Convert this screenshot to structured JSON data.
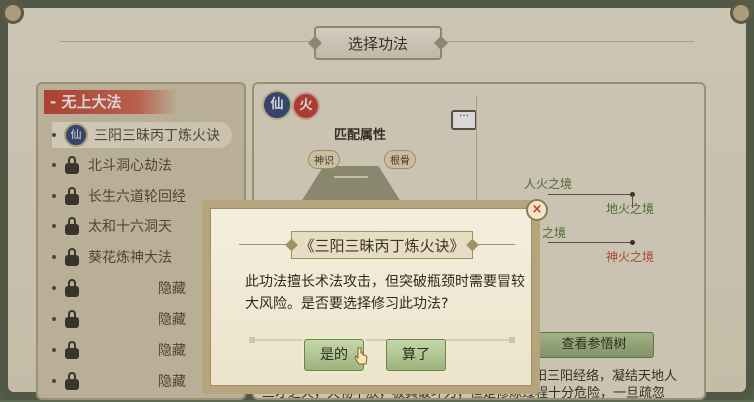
{
  "header": {
    "title": "选择功法"
  },
  "left_panel": {
    "category": "无上大法",
    "items": [
      {
        "label": "三阳三昧丙丁炼火诀",
        "state": "selected",
        "icon": "xian-icon"
      },
      {
        "label": "北斗洞心劫法",
        "state": "locked",
        "icon": "lock-icon"
      },
      {
        "label": "长生六道轮回经",
        "state": "locked",
        "icon": "lock-icon"
      },
      {
        "label": "太和十六洞天",
        "state": "locked",
        "icon": "lock-icon"
      },
      {
        "label": "葵花炼神大法",
        "state": "locked",
        "icon": "lock-icon"
      },
      {
        "label": "隐藏",
        "state": "hidden",
        "icon": "lock-icon"
      },
      {
        "label": "隐藏",
        "state": "hidden",
        "icon": "lock-icon"
      },
      {
        "label": "隐藏",
        "state": "hidden",
        "icon": "lock-icon"
      },
      {
        "label": "隐藏",
        "state": "hidden",
        "icon": "lock-icon"
      }
    ]
  },
  "detail": {
    "badge_type": "仙",
    "badge_element": "火",
    "attr_title": "匹配属性",
    "attr_left": "神识",
    "attr_right": "根骨",
    "tree": {
      "node_human": "人火之境",
      "node_earth": "地火之境",
      "node_partial": "之境",
      "node_divine": "神火之境"
    },
    "view_tree_button": "查看参悟树",
    "text_line1_right": "阳三阳经络，凝结天地人",
    "text_line2_left": "三才之火，天物不放，极具破坏力，但是修炼过程十分危险，一旦疏忽",
    "colors": {
      "accent_red": "#c23b2e",
      "node_green": "#5a7a3a",
      "node_red": "#c0533a"
    }
  },
  "modal": {
    "title": "《三阳三昧丙丁炼火诀》",
    "message": "此功法擅长术法攻击，但突破瓶颈时需要冒较大风险。是否要选择修习此功法?",
    "confirm_label": "是的",
    "cancel_label": "算了",
    "close_icon": "×"
  }
}
